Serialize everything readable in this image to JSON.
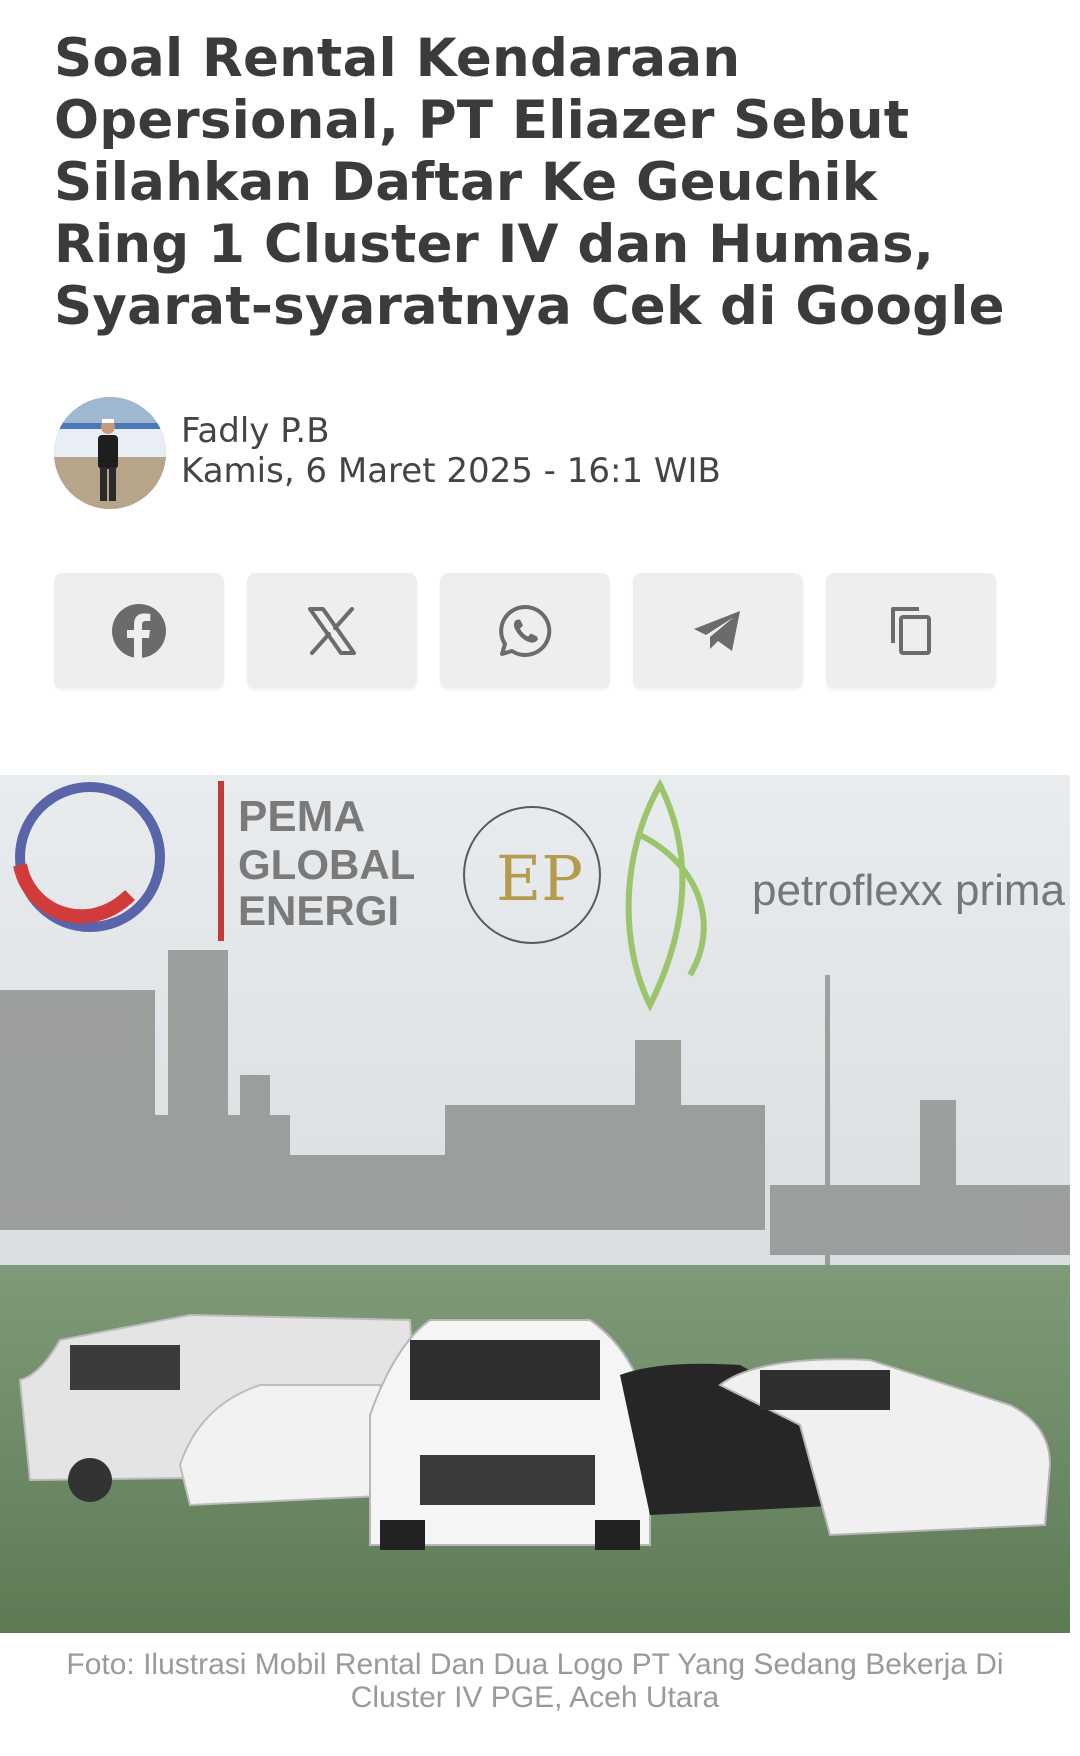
{
  "article": {
    "title": "Soal Rental Kendaraan Opersional, PT Eliazer Sebut Silahkan Daftar Ke Geuchik Ring 1 Cluster IV dan Humas, Syarat-syaratnya Cek di Google",
    "author": "Fadly P.B",
    "date": "Kamis, 6 Maret 2025 - 16:1 WIB"
  },
  "share": {
    "buttons": [
      {
        "icon": "facebook-icon"
      },
      {
        "icon": "x-icon"
      },
      {
        "icon": "whatsapp-icon"
      },
      {
        "icon": "telegram-icon"
      },
      {
        "icon": "copy-icon"
      }
    ]
  },
  "image": {
    "logos": {
      "pema_line1": "PEMA",
      "pema_line2": "GLOBAL",
      "pema_line3": "ENERGI",
      "ep_monogram": "EP",
      "petroflexx": "petroflexx prima daya"
    },
    "caption": "Foto: Ilustrasi Mobil Rental Dan Dua Logo PT Yang Sedang Bekerja Di Cluster IV PGE, Aceh Utara"
  },
  "colors": {
    "title_text": "#3b3b3b",
    "button_bg": "#eeeeee",
    "icon_gray": "#6b6b6b",
    "caption_text": "#9a9a9a"
  }
}
